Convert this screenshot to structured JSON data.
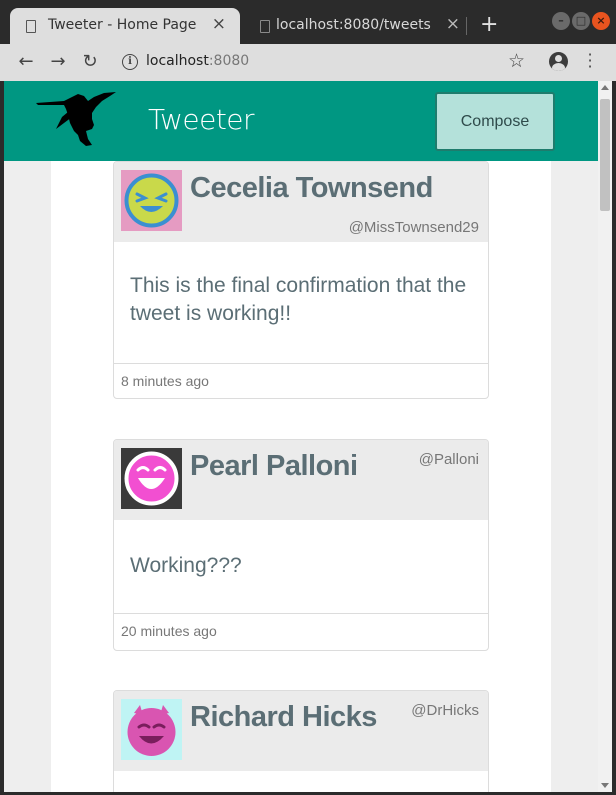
{
  "browser": {
    "tabs": [
      {
        "title": "Tweeter - Home Page",
        "active": true
      },
      {
        "title": "localhost:8080/tweets",
        "active": false
      }
    ],
    "address": {
      "host": "localhost",
      "port": ":8080"
    }
  },
  "app": {
    "brand": "Tweeter",
    "compose_label": "Compose",
    "colors": {
      "accent": "#009782",
      "compose_bg": "#b4e1da",
      "text": "#5b6e75"
    }
  },
  "tweets": [
    {
      "name": "Cecelia Townsend",
      "handle": "@MissTownsend29",
      "text": "This is the final confirmation that the tweet is working!!",
      "time": "8 minutes ago",
      "avatar_icon": "laughing-face-avatar-icon",
      "avatar_bg": "#e59bc2"
    },
    {
      "name": "Pearl Palloni",
      "handle": "@Palloni",
      "text": "Working???",
      "time": "20 minutes ago",
      "avatar_icon": "laughing-face-avatar-icon",
      "avatar_bg": "#3a3a3a"
    },
    {
      "name": "Richard Hicks",
      "handle": "@DrHicks",
      "text": "",
      "time": "",
      "avatar_icon": "devil-face-avatar-icon",
      "avatar_bg": "#bff4f4"
    }
  ]
}
